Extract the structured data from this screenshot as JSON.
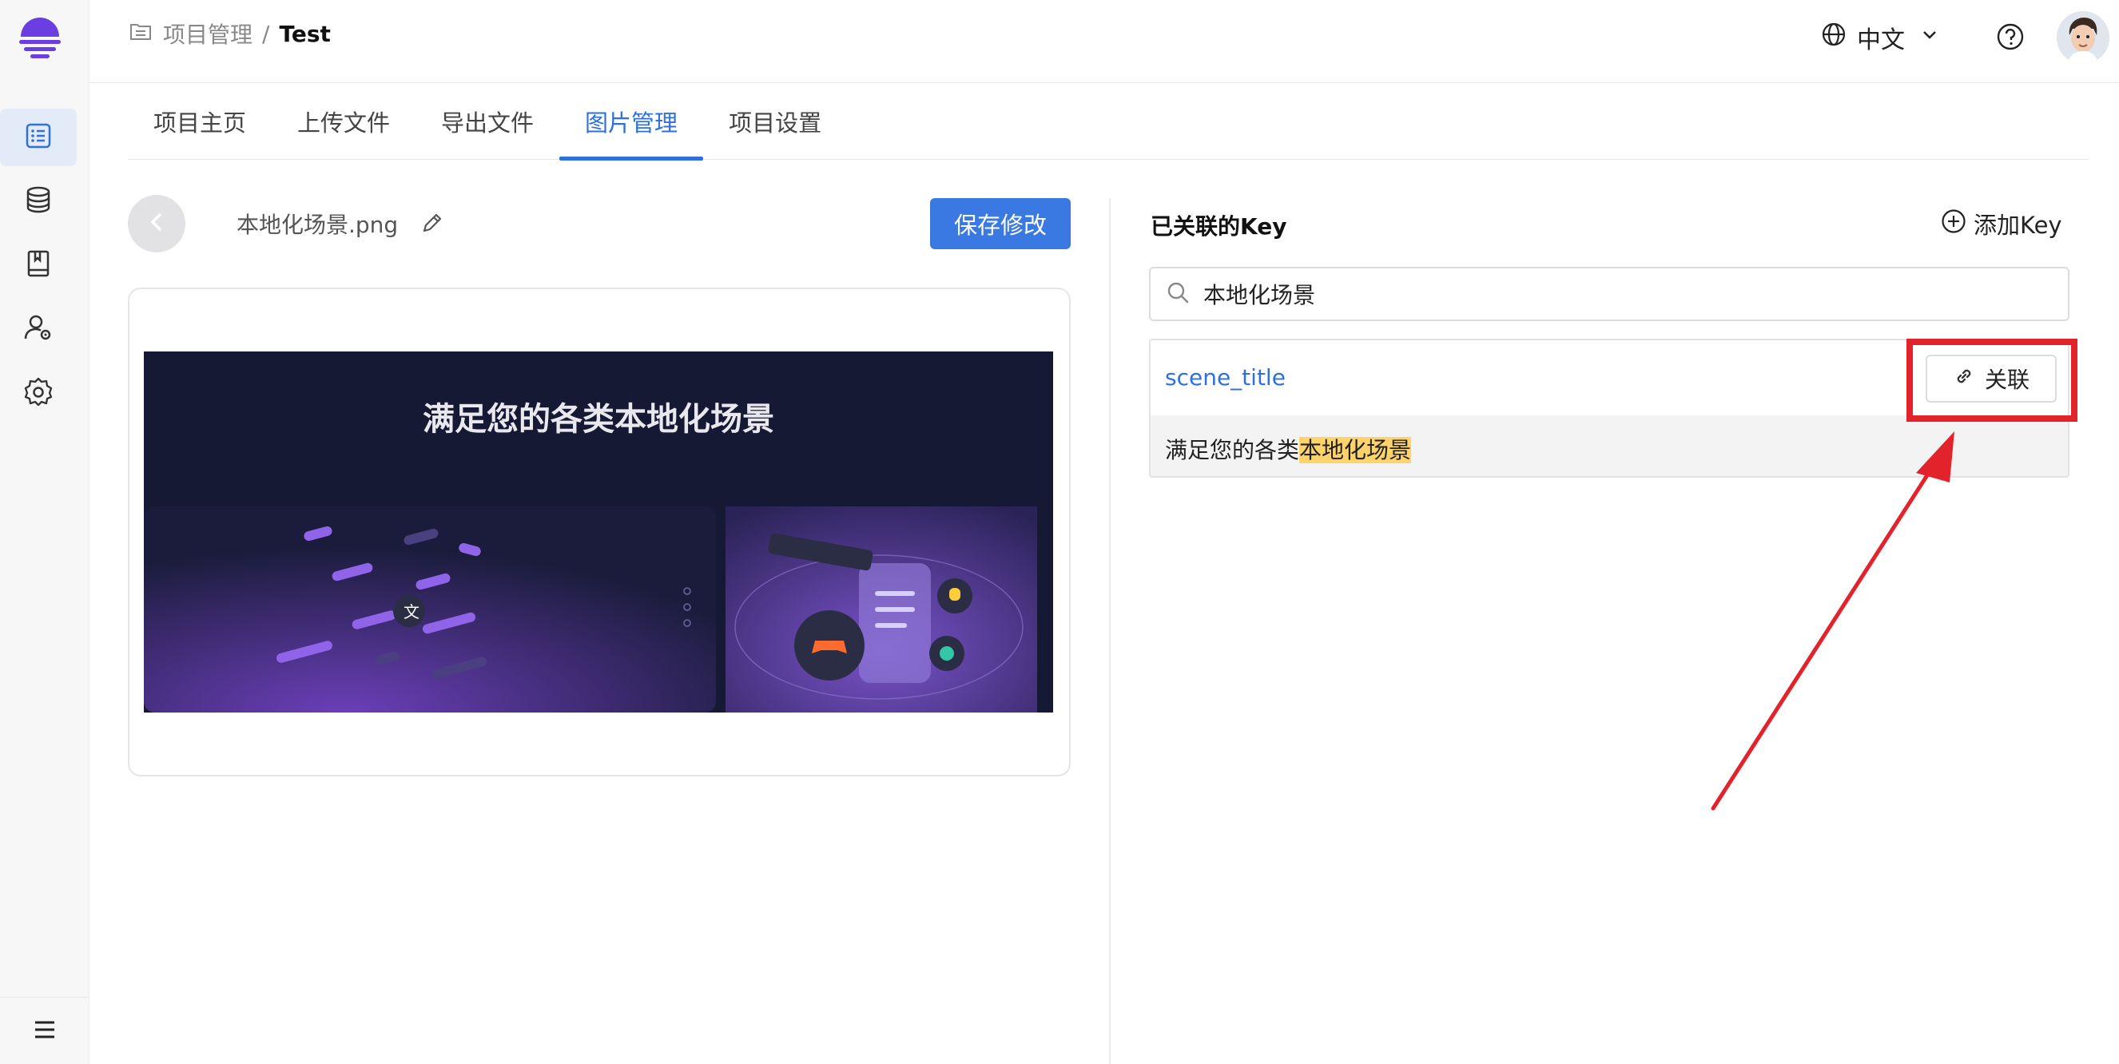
{
  "breadcrumb": {
    "parent": "项目管理",
    "separator": "/",
    "current": "Test"
  },
  "header": {
    "language": "中文"
  },
  "tabs": [
    {
      "label": "项目主页",
      "active": false
    },
    {
      "label": "上传文件",
      "active": false
    },
    {
      "label": "导出文件",
      "active": false
    },
    {
      "label": "图片管理",
      "active": true
    },
    {
      "label": "项目设置",
      "active": false
    }
  ],
  "image_panel": {
    "file_name": "本地化场景.png",
    "save_label": "保存修改",
    "preview_title": "满足您的各类本地化场景"
  },
  "keys_panel": {
    "title": "已关联的Key",
    "add_label": "添加Key",
    "search_value": "本地化场景",
    "result": {
      "key": "scene_title",
      "value_prefix": "满足您的各类",
      "value_highlight": "本地化场景",
      "link_label": "关联"
    }
  },
  "colors": {
    "accent": "#3a78e2",
    "annotation": "#e3232c",
    "highlight": "#ffd36b",
    "logo": "#6a3ee0"
  },
  "icons": {
    "sidebar": [
      "file-list-icon",
      "database-icon",
      "book-icon",
      "user-settings-icon",
      "gear-icon"
    ],
    "menu": "menu-icon"
  }
}
